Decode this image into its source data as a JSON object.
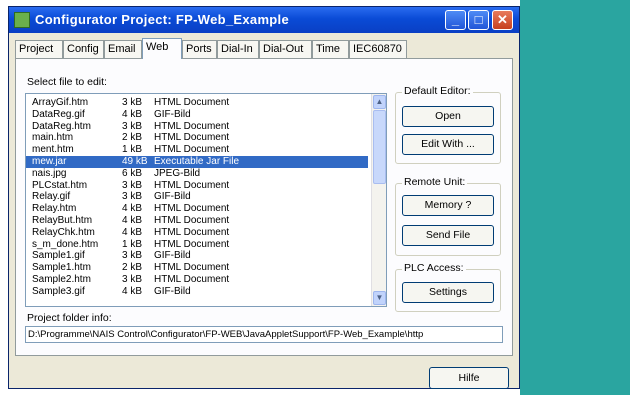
{
  "window": {
    "title": "Configurator Project: FP-Web_Example",
    "min_glyph": "_",
    "max_glyph": "□",
    "close_glyph": "✕"
  },
  "tabs": [
    {
      "label": "Project",
      "active": false
    },
    {
      "label": "Config",
      "active": false
    },
    {
      "label": "Email",
      "active": false
    },
    {
      "label": "Web",
      "active": true
    },
    {
      "label": "Ports",
      "active": false
    },
    {
      "label": "Dial-In",
      "active": false
    },
    {
      "label": "Dial-Out",
      "active": false
    },
    {
      "label": "Time",
      "active": false
    },
    {
      "label": "IEC60870",
      "active": false
    }
  ],
  "file_list": {
    "label": "Select file to edit:",
    "rows": [
      {
        "name": "ArrayGif.htm",
        "size": "3 kB",
        "type": "HTML Document",
        "selected": false
      },
      {
        "name": "DataReg.gif",
        "size": "4 kB",
        "type": "GIF-Bild",
        "selected": false
      },
      {
        "name": "DataReg.htm",
        "size": "3 kB",
        "type": "HTML Document",
        "selected": false
      },
      {
        "name": "main.htm",
        "size": "2 kB",
        "type": "HTML Document",
        "selected": false
      },
      {
        "name": "ment.htm",
        "size": "1 kB",
        "type": "HTML Document",
        "selected": false
      },
      {
        "name": "mew.jar",
        "size": "49 kB",
        "type": "Executable Jar File",
        "selected": true
      },
      {
        "name": "nais.jpg",
        "size": "6 kB",
        "type": "JPEG-Bild",
        "selected": false
      },
      {
        "name": "PLCstat.htm",
        "size": "3 kB",
        "type": "HTML Document",
        "selected": false
      },
      {
        "name": "Relay.gif",
        "size": "3 kB",
        "type": "GIF-Bild",
        "selected": false
      },
      {
        "name": "Relay.htm",
        "size": "4 kB",
        "type": "HTML Document",
        "selected": false
      },
      {
        "name": "RelayBut.htm",
        "size": "4 kB",
        "type": "HTML Document",
        "selected": false
      },
      {
        "name": "RelayChk.htm",
        "size": "4 kB",
        "type": "HTML Document",
        "selected": false
      },
      {
        "name": "s_m_done.htm",
        "size": "1 kB",
        "type": "HTML Document",
        "selected": false
      },
      {
        "name": "Sample1.gif",
        "size": "3 kB",
        "type": "GIF-Bild",
        "selected": false
      },
      {
        "name": "Sample1.htm",
        "size": "2 kB",
        "type": "HTML Document",
        "selected": false
      },
      {
        "name": "Sample2.htm",
        "size": "3 kB",
        "type": "HTML Document",
        "selected": false
      },
      {
        "name": "Sample3.gif",
        "size": "4 kB",
        "type": "GIF-Bild",
        "selected": false
      }
    ],
    "scroll_up_glyph": "▲",
    "scroll_down_glyph": "▼"
  },
  "default_editor": {
    "title": "Default Editor:",
    "open_label": "Open",
    "edit_with_label": "Edit With ..."
  },
  "remote_unit": {
    "title": "Remote Unit:",
    "memory_label": "Memory ?",
    "send_file_label": "Send File"
  },
  "plc_access": {
    "title": "PLC Access:",
    "settings_label": "Settings"
  },
  "project_folder": {
    "label": "Project folder info:",
    "path": "D:\\Programme\\NAIS Control\\Configurator\\FP-WEB\\JavaAppletSupport\\FP-Web_Example\\http"
  },
  "help_label": "Hilfe",
  "colors": {
    "accent_teal": "#2aa5a0",
    "selection": "#316ac5",
    "titlebar": "#0a4bd6"
  }
}
